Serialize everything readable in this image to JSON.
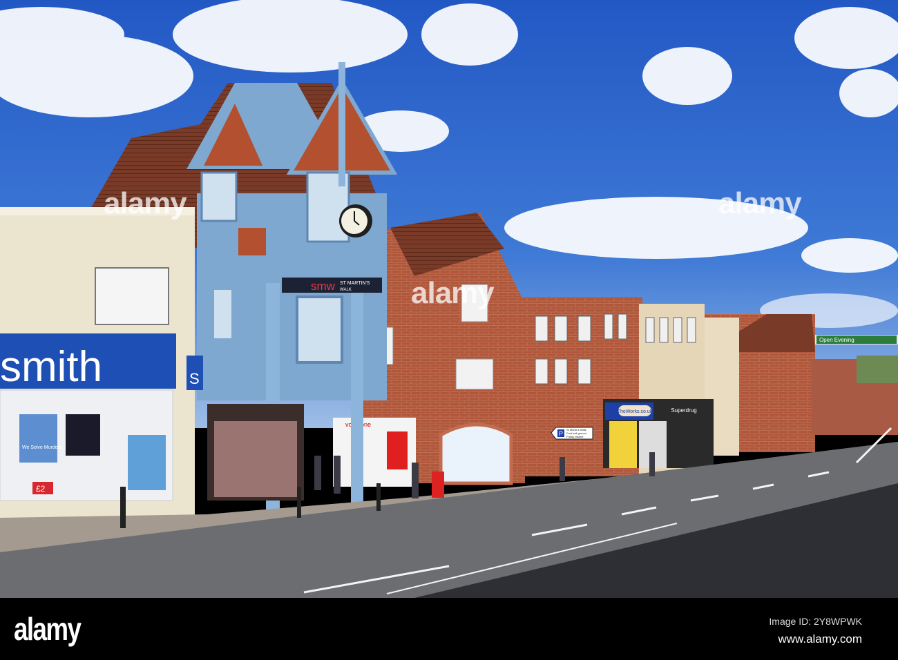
{
  "photo": {
    "signs": {
      "smith": "smith",
      "whsmith_badge": "S",
      "smw_logo": "smw",
      "st_martins": "ST MARTIN'S",
      "walk": "WALK",
      "vodafone": "vodafone",
      "the_works": "TheWorks.co.uk",
      "superdrug": "Superdrug",
      "direction_line1": "St Martin's Walk",
      "direction_line2": "Foot ball ground",
      "direction_line3": "Friday Market",
      "parking": "P",
      "banner": "Open Evening",
      "poster": "We Solve Murders",
      "price": "£2"
    },
    "colors": {
      "sky": "#2f66c9",
      "brick": "#b0563a",
      "tower_blue": "#7fa8d0",
      "road": "#5d5f63"
    }
  },
  "watermark": {
    "text": "alamy"
  },
  "footer": {
    "logo": "alamy",
    "image_id": "Image ID: 2Y8WPWK",
    "site": "www.alamy.com"
  }
}
